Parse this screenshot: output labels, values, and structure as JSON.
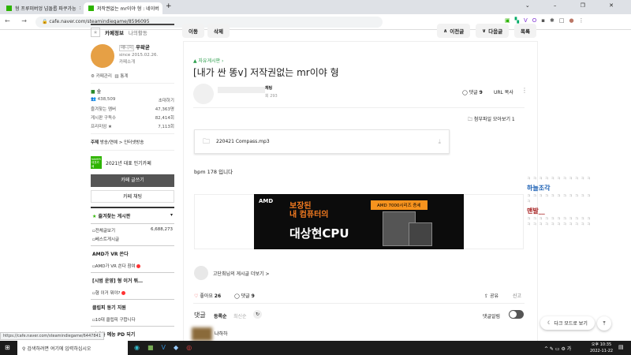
{
  "browser": {
    "tabs": [
      {
        "title": "형 프루미버엉 넘돌롭 파쿠가능"
      },
      {
        "title": "저작권없는 mr이야 형 : 네이버"
      }
    ],
    "url": "cafe.naver.com/steamindiegame/8596095",
    "status_url": "https://cafe.naver.com/steamindiegame/6447841"
  },
  "sidebar": {
    "tab_info": "카페정보",
    "tab_activity": "나의활동",
    "manager_badge": "매니저",
    "cafe_owner": "우왁굳",
    "since": "since 2015.02.26.",
    "intro_link": "카페소개",
    "manage": "카페관리",
    "stats": "통계",
    "grade": "숲",
    "members": "438,509",
    "invite": "초대하기",
    "stat_rows": [
      {
        "label": "즐겨찾는 멤버",
        "value": "47,363명"
      },
      {
        "label": "게시판 구독수",
        "value": "82,414회"
      },
      {
        "label": "프리미엄 ★",
        "value": "7,113회"
      }
    ],
    "topic_label": "주제",
    "topic": "방송/연예 > 인터넷방송",
    "award": "2021년 대표 인기카페",
    "naver_badge": "NAVER 대표카페",
    "write": "카페 글쓰기",
    "chat": "카페 채팅",
    "fav_boards": "즐겨찾는 게시판",
    "boards": [
      {
        "type": "item",
        "label": "전체글보기",
        "count": "6,688,273"
      },
      {
        "type": "item",
        "label": "베스트게시글"
      },
      {
        "type": "head",
        "label": "AMD가 VR 쏜다"
      },
      {
        "type": "item",
        "label": "AMD가 VR 쏜다 참여",
        "new": true
      },
      {
        "type": "head",
        "label": "[시범 운영] 형 이거 뭐…"
      },
      {
        "type": "item",
        "label": "형 이거 뭐야?",
        "new": true
      },
      {
        "type": "head",
        "label": "클립피 동기 지원"
      },
      {
        "type": "item",
        "label": "10대 클립피 구합니다"
      },
      {
        "type": "head",
        "label": "이세돌 예능 PD 되기"
      }
    ]
  },
  "toolbar": {
    "move": "이동",
    "delete": "삭제",
    "prev": "이전글",
    "next": "다음글",
    "list": "목록"
  },
  "post": {
    "board": "자유게시판",
    "title": "[내가 싼 똥v] 저작권없는 mr이야 형",
    "author_tag": "채팅",
    "views": "회 293",
    "comments_label": "댓글",
    "comments_count": "9",
    "copy_url": "URL 복사",
    "attachments": "첨부파일 모아보기 1",
    "file_name": "220421 Compass.mp3",
    "body": "bpm 178 입니다",
    "ad": {
      "brand": "AMD",
      "line1": "보장된",
      "line2": "내 컴퓨터의",
      "line3": "대상현CPU",
      "tag": "AMD 7000시리즈 증세"
    },
    "more_posts": "고단최님의 게시글 더보기 >",
    "like_label": "좋아요",
    "like_count": "26",
    "share": "공유",
    "report": "신고",
    "comments_title": "댓글",
    "sort_reg": "등록순",
    "sort_new": "최신순",
    "notify": "댓글알림",
    "comment_author": "냐하하"
  },
  "chat": {
    "users": [
      {
        "name": "하늘조각",
        "color": "#1a5fb4"
      },
      {
        "name": "맨발__",
        "color": "#a51d1d"
      }
    ],
    "dark_mode": "다크 모드로 보기"
  },
  "taskbar": {
    "search": "검색하려면 여기에 입력하십시오",
    "time": "오후 10:35",
    "date": "2022-11-22"
  }
}
